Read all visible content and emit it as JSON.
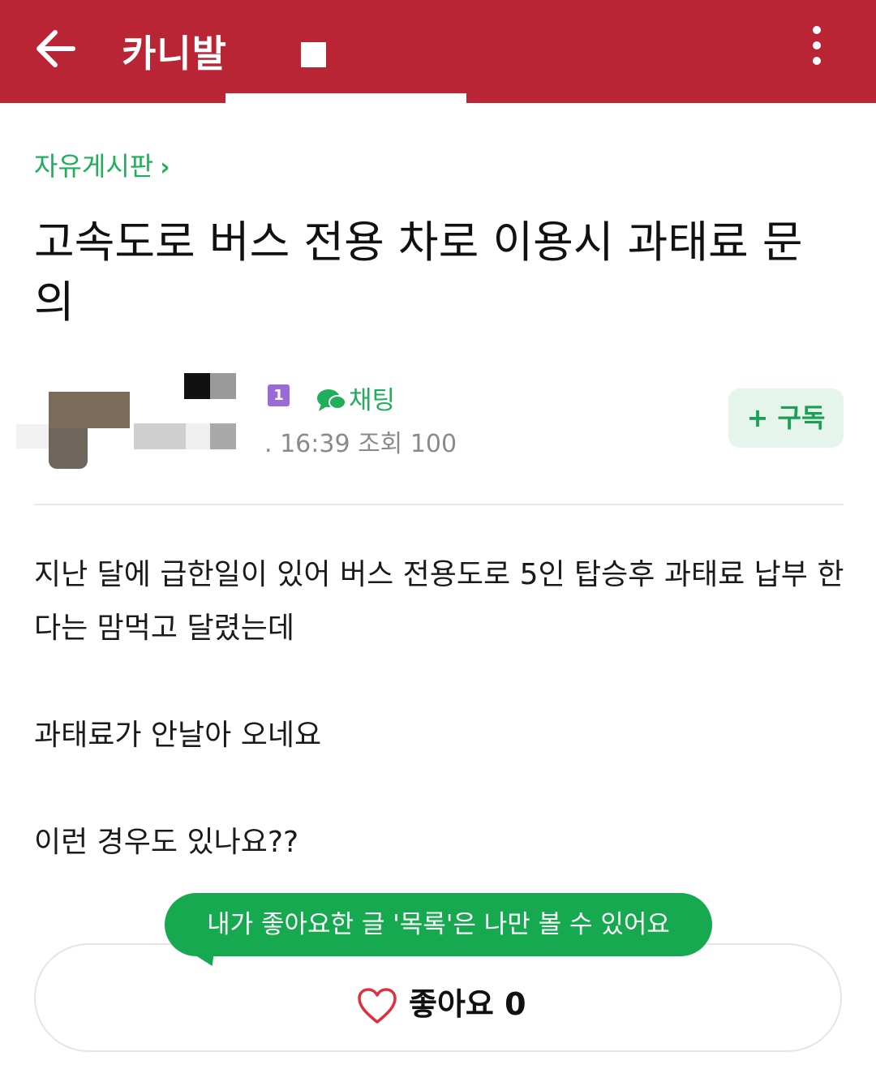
{
  "header": {
    "cafe_name": "카니발",
    "colors": {
      "header_bg": "#b92535",
      "accent_green": "#1fae5a"
    }
  },
  "post": {
    "board_name": "자유게시판",
    "title": "고속도로 버스 전용 차로 이용시 과태료 문의",
    "author": {
      "level": "1",
      "chat_label": "채팅",
      "meta_partial": ". 16:39",
      "views_label": "조회",
      "views": "100"
    },
    "subscribe_label": "+ 구독",
    "content": [
      "지난 달에 급한일이 있어 버스 전용도로 5인 탑승후 과태료 납부 한다는 맘먹고 달렸는데",
      "과태료가 안날아 오네요",
      "이런 경우도 있나요??"
    ]
  },
  "tooltip": "내가 좋아요한 글 '목록'은 나만 볼 수 있어요",
  "like": {
    "label": "좋아요",
    "count": "0"
  }
}
